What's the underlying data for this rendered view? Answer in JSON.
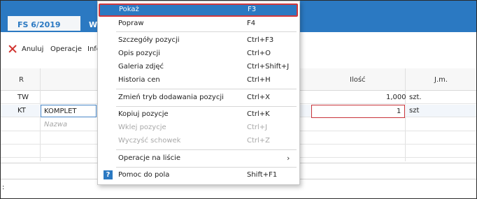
{
  "tabs": [
    {
      "label": "FS 6/2019"
    },
    {
      "label": "W"
    }
  ],
  "toolbar": {
    "cancel_label": "Anuluj",
    "operations_label": "Operacje",
    "info_label": "Info"
  },
  "grid": {
    "columns": {
      "r": "R",
      "qty": "Ilość",
      "unit": "J.m."
    },
    "rows": [
      {
        "r": "TW",
        "name": "",
        "qty": "1,000",
        "unit": "szt."
      },
      {
        "r": "KT",
        "name": "KOMPLET",
        "qty": "1",
        "unit": "szt"
      }
    ],
    "new_row_placeholder": "Nazwa"
  },
  "status": {
    "text": ":"
  },
  "context_menu": {
    "items": [
      {
        "label": "Pokaż",
        "shortcut": "F3"
      },
      {
        "label": "Popraw",
        "shortcut": "F4"
      },
      {
        "label": "Szczegóły pozycji",
        "shortcut": "Ctrl+F3"
      },
      {
        "label": "Opis pozycji",
        "shortcut": "Ctrl+O"
      },
      {
        "label": "Galeria zdjęć",
        "shortcut": "Ctrl+Shift+J"
      },
      {
        "label": "Historia cen",
        "shortcut": "Ctrl+H"
      },
      {
        "label": "Zmień tryb dodawania pozycji",
        "shortcut": "Ctrl+X"
      },
      {
        "label": "Kopiuj pozycje",
        "shortcut": "Ctrl+K"
      },
      {
        "label": "Wklej pozycje",
        "shortcut": "Ctrl+J"
      },
      {
        "label": "Wyczyść schowek",
        "shortcut": "Ctrl+Z"
      },
      {
        "label": "Operacje na liście",
        "shortcut": ""
      },
      {
        "label": "Pomoc do pola",
        "shortcut": "Shift+F1"
      }
    ],
    "submenu_icon": "chevron-right-icon",
    "help_icon": "question-mark-icon"
  },
  "colors": {
    "accent": "#2b79c2",
    "selection_border": "#d2383c",
    "cancel_icon": "#d0312d"
  }
}
